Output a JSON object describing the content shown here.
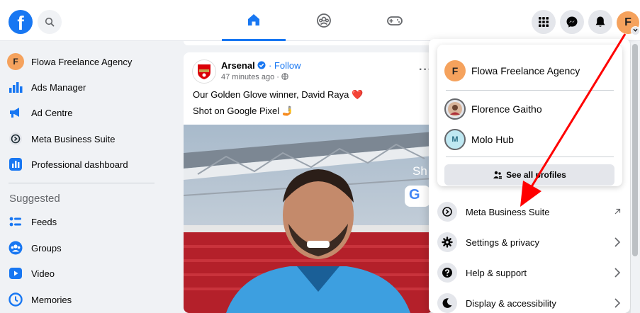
{
  "topbar": {
    "logo_letter": "f",
    "avatar_letter": "F"
  },
  "sidebar": {
    "items": [
      {
        "label": "Flowa Freelance Agency",
        "icon": "profile-avatar",
        "avatar_letter": "F"
      },
      {
        "label": "Ads Manager",
        "icon": "bar-chart-icon"
      },
      {
        "label": "Ad Centre",
        "icon": "megaphone-icon"
      },
      {
        "label": "Meta Business Suite",
        "icon": "meta-business-suite-icon"
      },
      {
        "label": "Professional dashboard",
        "icon": "dashboard-icon"
      }
    ],
    "suggested_heading": "Suggested",
    "suggested": [
      {
        "label": "Feeds",
        "icon": "feeds-icon"
      },
      {
        "label": "Groups",
        "icon": "groups-icon"
      },
      {
        "label": "Video",
        "icon": "video-icon"
      },
      {
        "label": "Memories",
        "icon": "memories-icon"
      }
    ]
  },
  "post": {
    "author": "Arsenal",
    "separator": "·",
    "follow_label": "Follow",
    "time": "47 minutes ago",
    "dots": "···",
    "line1": "Our Golden Glove winner, David Raya ❤️",
    "line2": "Shot on Google Pixel 🤳",
    "overlay_text": "Sh",
    "overlay_logo": "G"
  },
  "menu": {
    "profiles": [
      {
        "label": "Flowa Freelance Agency",
        "avatar_letter": "F"
      },
      {
        "label": "Florence Gaitho"
      },
      {
        "label": "Molo Hub",
        "avatar_letter": "M"
      }
    ],
    "see_all_label": "See all profiles",
    "items": [
      {
        "label": "Meta Business Suite",
        "icon": "meta-business-suite-icon",
        "trailing": "external-link-icon"
      },
      {
        "label": "Settings & privacy",
        "icon": "gear-icon",
        "trailing": "chevron-right-icon"
      },
      {
        "label": "Help & support",
        "icon": "question-icon",
        "trailing": "chevron-right-icon"
      },
      {
        "label": "Display & accessibility",
        "icon": "moon-icon",
        "trailing": "chevron-right-icon"
      }
    ]
  },
  "colors": {
    "brand_blue": "#1877f2",
    "avatar_orange": "#f5a25d",
    "annotation_arrow": "#ff0000"
  }
}
